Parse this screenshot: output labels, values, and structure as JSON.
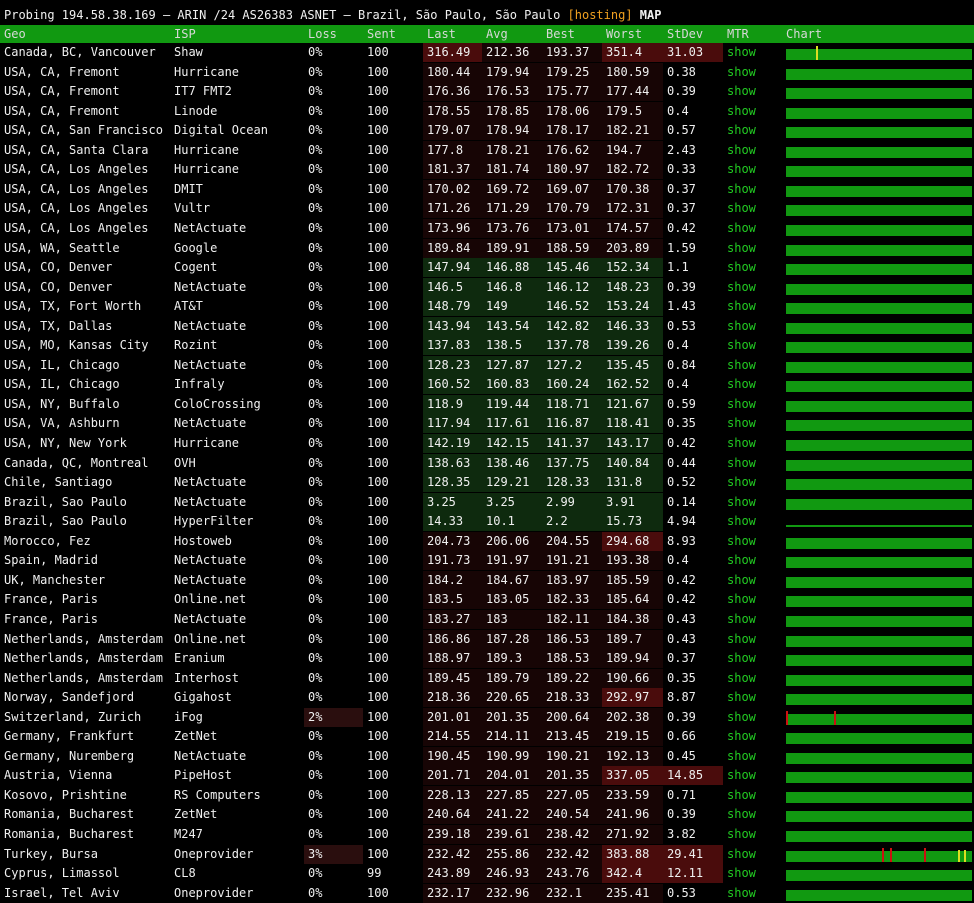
{
  "title": {
    "prefix": "Probing 194.58.38.169 – ARIN /24 AS26383 ASNET – Brazil, São Paulo, São Paulo ",
    "tag": "[hosting]",
    "map": "MAP"
  },
  "columns": [
    "Geo",
    "ISP",
    "Loss",
    "Sent",
    "Last",
    "Avg",
    "Best",
    "Worst",
    "StDev",
    "MTR",
    "Chart"
  ],
  "colors": {
    "header_bg": "#119911",
    "link": "#22cc22",
    "bar": "#119911",
    "good_bg": "#0e2a0e",
    "bad_bg": "#4a0c0c",
    "warn_bg": "#2a0e0e",
    "spike_red": "#cc1111",
    "spike_yellow": "#dddd22"
  },
  "rows": [
    {
      "geo": "Canada, BC, Vancouver",
      "isp": "Shaw",
      "loss": "0%",
      "sent": "100",
      "last": "316.49",
      "avg": "212.36",
      "best": "193.37",
      "worst": "351.4",
      "stdev": "31.03",
      "mtr": "show",
      "tone": "bad",
      "worst_bad": true,
      "stdev_bad": true
    },
    {
      "geo": "USA, CA, Fremont",
      "isp": "Hurricane",
      "loss": "0%",
      "sent": "100",
      "last": "180.44",
      "avg": "179.94",
      "best": "179.25",
      "worst": "180.59",
      "stdev": "0.38",
      "mtr": "show",
      "tone": "bad"
    },
    {
      "geo": "USA, CA, Fremont",
      "isp": "IT7 FMT2",
      "loss": "0%",
      "sent": "100",
      "last": "176.36",
      "avg": "176.53",
      "best": "175.77",
      "worst": "177.44",
      "stdev": "0.39",
      "mtr": "show",
      "tone": "bad"
    },
    {
      "geo": "USA, CA, Fremont",
      "isp": "Linode",
      "loss": "0%",
      "sent": "100",
      "last": "178.55",
      "avg": "178.85",
      "best": "178.06",
      "worst": "179.5",
      "stdev": "0.4",
      "mtr": "show",
      "tone": "bad"
    },
    {
      "geo": "USA, CA, San Francisco",
      "isp": "Digital Ocean",
      "loss": "0%",
      "sent": "100",
      "last": "179.07",
      "avg": "178.94",
      "best": "178.17",
      "worst": "182.21",
      "stdev": "0.57",
      "mtr": "show",
      "tone": "bad"
    },
    {
      "geo": "USA, CA, Santa Clara",
      "isp": "Hurricane",
      "loss": "0%",
      "sent": "100",
      "last": "177.8",
      "avg": "178.21",
      "best": "176.62",
      "worst": "194.7",
      "stdev": "2.43",
      "mtr": "show",
      "tone": "bad"
    },
    {
      "geo": "USA, CA, Los Angeles",
      "isp": "Hurricane",
      "loss": "0%",
      "sent": "100",
      "last": "181.37",
      "avg": "181.74",
      "best": "180.97",
      "worst": "182.72",
      "stdev": "0.33",
      "mtr": "show",
      "tone": "bad"
    },
    {
      "geo": "USA, CA, Los Angeles",
      "isp": "DMIT",
      "loss": "0%",
      "sent": "100",
      "last": "170.02",
      "avg": "169.72",
      "best": "169.07",
      "worst": "170.38",
      "stdev": "0.37",
      "mtr": "show",
      "tone": "bad"
    },
    {
      "geo": "USA, CA, Los Angeles",
      "isp": "Vultr",
      "loss": "0%",
      "sent": "100",
      "last": "171.26",
      "avg": "171.29",
      "best": "170.79",
      "worst": "172.31",
      "stdev": "0.37",
      "mtr": "show",
      "tone": "bad"
    },
    {
      "geo": "USA, CA, Los Angeles",
      "isp": "NetActuate",
      "loss": "0%",
      "sent": "100",
      "last": "173.96",
      "avg": "173.76",
      "best": "173.01",
      "worst": "174.57",
      "stdev": "0.42",
      "mtr": "show",
      "tone": "bad"
    },
    {
      "geo": "USA, WA, Seattle",
      "isp": "Google",
      "loss": "0%",
      "sent": "100",
      "last": "189.84",
      "avg": "189.91",
      "best": "188.59",
      "worst": "203.89",
      "stdev": "1.59",
      "mtr": "show",
      "tone": "bad"
    },
    {
      "geo": "USA, CO, Denver",
      "isp": "Cogent",
      "loss": "0%",
      "sent": "100",
      "last": "147.94",
      "avg": "146.88",
      "best": "145.46",
      "worst": "152.34",
      "stdev": "1.1",
      "mtr": "show",
      "tone": "good"
    },
    {
      "geo": "USA, CO, Denver",
      "isp": "NetActuate",
      "loss": "0%",
      "sent": "100",
      "last": "146.5",
      "avg": "146.8",
      "best": "146.12",
      "worst": "148.23",
      "stdev": "0.39",
      "mtr": "show",
      "tone": "good"
    },
    {
      "geo": "USA, TX, Fort Worth",
      "isp": "AT&T",
      "loss": "0%",
      "sent": "100",
      "last": "148.79",
      "avg": "149",
      "best": "146.52",
      "worst": "153.24",
      "stdev": "1.43",
      "mtr": "show",
      "tone": "good"
    },
    {
      "geo": "USA, TX, Dallas",
      "isp": "NetActuate",
      "loss": "0%",
      "sent": "100",
      "last": "143.94",
      "avg": "143.54",
      "best": "142.82",
      "worst": "146.33",
      "stdev": "0.53",
      "mtr": "show",
      "tone": "good"
    },
    {
      "geo": "USA, MO, Kansas City",
      "isp": "Rozint",
      "loss": "0%",
      "sent": "100",
      "last": "137.83",
      "avg": "138.5",
      "best": "137.78",
      "worst": "139.26",
      "stdev": "0.4",
      "mtr": "show",
      "tone": "good"
    },
    {
      "geo": "USA, IL, Chicago",
      "isp": "NetActuate",
      "loss": "0%",
      "sent": "100",
      "last": "128.23",
      "avg": "127.87",
      "best": "127.2",
      "worst": "135.45",
      "stdev": "0.84",
      "mtr": "show",
      "tone": "good"
    },
    {
      "geo": "USA, IL, Chicago",
      "isp": "Infraly",
      "loss": "0%",
      "sent": "100",
      "last": "160.52",
      "avg": "160.83",
      "best": "160.24",
      "worst": "162.52",
      "stdev": "0.4",
      "mtr": "show",
      "tone": "good"
    },
    {
      "geo": "USA, NY, Buffalo",
      "isp": "ColoCrossing",
      "loss": "0%",
      "sent": "100",
      "last": "118.9",
      "avg": "119.44",
      "best": "118.71",
      "worst": "121.67",
      "stdev": "0.59",
      "mtr": "show",
      "tone": "good"
    },
    {
      "geo": "USA, VA, Ashburn",
      "isp": "NetActuate",
      "loss": "0%",
      "sent": "100",
      "last": "117.94",
      "avg": "117.61",
      "best": "116.87",
      "worst": "118.41",
      "stdev": "0.35",
      "mtr": "show",
      "tone": "good"
    },
    {
      "geo": "USA, NY, New York",
      "isp": "Hurricane",
      "loss": "0%",
      "sent": "100",
      "last": "142.19",
      "avg": "142.15",
      "best": "141.37",
      "worst": "143.17",
      "stdev": "0.42",
      "mtr": "show",
      "tone": "good"
    },
    {
      "geo": "Canada, QC, Montreal",
      "isp": "OVH",
      "loss": "0%",
      "sent": "100",
      "last": "138.63",
      "avg": "138.46",
      "best": "137.75",
      "worst": "140.84",
      "stdev": "0.44",
      "mtr": "show",
      "tone": "good"
    },
    {
      "geo": "Chile, Santiago",
      "isp": "NetActuate",
      "loss": "0%",
      "sent": "100",
      "last": "128.35",
      "avg": "129.21",
      "best": "128.33",
      "worst": "131.8",
      "stdev": "0.52",
      "mtr": "show",
      "tone": "good"
    },
    {
      "geo": "Brazil, Sao Paulo",
      "isp": "NetActuate",
      "loss": "0%",
      "sent": "100",
      "last": "3.25",
      "avg": "3.25",
      "best": "2.99",
      "worst": "3.91",
      "stdev": "0.14",
      "mtr": "show",
      "tone": "good"
    },
    {
      "geo": "Brazil, Sao Paulo",
      "isp": "HyperFilter",
      "loss": "0%",
      "sent": "100",
      "last": "14.33",
      "avg": "10.1",
      "best": "2.2",
      "worst": "15.73",
      "stdev": "4.94",
      "mtr": "show",
      "tone": "good",
      "chart": "thin"
    },
    {
      "geo": "Morocco, Fez",
      "isp": "Hostoweb",
      "loss": "0%",
      "sent": "100",
      "last": "204.73",
      "avg": "206.06",
      "best": "204.55",
      "worst": "294.68",
      "stdev": "8.93",
      "mtr": "show",
      "tone": "bad",
      "worst_bad": true
    },
    {
      "geo": "Spain, Madrid",
      "isp": "NetActuate",
      "loss": "0%",
      "sent": "100",
      "last": "191.73",
      "avg": "191.97",
      "best": "191.21",
      "worst": "193.38",
      "stdev": "0.4",
      "mtr": "show",
      "tone": "bad"
    },
    {
      "geo": "UK, Manchester",
      "isp": "NetActuate",
      "loss": "0%",
      "sent": "100",
      "last": "184.2",
      "avg": "184.67",
      "best": "183.97",
      "worst": "185.59",
      "stdev": "0.42",
      "mtr": "show",
      "tone": "bad"
    },
    {
      "geo": "France, Paris",
      "isp": "Online.net",
      "loss": "0%",
      "sent": "100",
      "last": "183.5",
      "avg": "183.05",
      "best": "182.33",
      "worst": "185.64",
      "stdev": "0.42",
      "mtr": "show",
      "tone": "bad"
    },
    {
      "geo": "France, Paris",
      "isp": "NetActuate",
      "loss": "0%",
      "sent": "100",
      "last": "183.27",
      "avg": "183",
      "best": "182.11",
      "worst": "184.38",
      "stdev": "0.43",
      "mtr": "show",
      "tone": "bad"
    },
    {
      "geo": "Netherlands, Amsterdam",
      "isp": "Online.net",
      "loss": "0%",
      "sent": "100",
      "last": "186.86",
      "avg": "187.28",
      "best": "186.53",
      "worst": "189.7",
      "stdev": "0.43",
      "mtr": "show",
      "tone": "bad"
    },
    {
      "geo": "Netherlands, Amsterdam",
      "isp": "Eranium",
      "loss": "0%",
      "sent": "100",
      "last": "188.97",
      "avg": "189.3",
      "best": "188.53",
      "worst": "189.94",
      "stdev": "0.37",
      "mtr": "show",
      "tone": "bad"
    },
    {
      "geo": "Netherlands, Amsterdam",
      "isp": "Interhost",
      "loss": "0%",
      "sent": "100",
      "last": "189.45",
      "avg": "189.79",
      "best": "189.22",
      "worst": "190.66",
      "stdev": "0.35",
      "mtr": "show",
      "tone": "bad"
    },
    {
      "geo": "Norway, Sandefjord",
      "isp": "Gigahost",
      "loss": "0%",
      "sent": "100",
      "last": "218.36",
      "avg": "220.65",
      "best": "218.33",
      "worst": "292.97",
      "stdev": "8.87",
      "mtr": "show",
      "tone": "bad",
      "worst_bad": true
    },
    {
      "geo": "Switzerland, Zurich",
      "isp": "iFog",
      "loss": "2%",
      "sent": "100",
      "last": "201.01",
      "avg": "201.35",
      "best": "200.64",
      "worst": "202.38",
      "stdev": "0.39",
      "mtr": "show",
      "tone": "bad",
      "loss_bad": true,
      "chart": "gaps"
    },
    {
      "geo": "Germany, Frankfurt",
      "isp": "ZetNet",
      "loss": "0%",
      "sent": "100",
      "last": "214.55",
      "avg": "214.11",
      "best": "213.45",
      "worst": "219.15",
      "stdev": "0.66",
      "mtr": "show",
      "tone": "bad"
    },
    {
      "geo": "Germany, Nuremberg",
      "isp": "NetActuate",
      "loss": "0%",
      "sent": "100",
      "last": "190.45",
      "avg": "190.99",
      "best": "190.21",
      "worst": "192.13",
      "stdev": "0.45",
      "mtr": "show",
      "tone": "bad"
    },
    {
      "geo": "Austria, Vienna",
      "isp": "PipeHost",
      "loss": "0%",
      "sent": "100",
      "last": "201.71",
      "avg": "204.01",
      "best": "201.35",
      "worst": "337.05",
      "stdev": "14.85",
      "mtr": "show",
      "tone": "bad",
      "worst_bad": true,
      "stdev_bad": true
    },
    {
      "geo": "Kosovo, Prishtine",
      "isp": "RS Computers",
      "loss": "0%",
      "sent": "100",
      "last": "228.13",
      "avg": "227.85",
      "best": "227.05",
      "worst": "233.59",
      "stdev": "0.71",
      "mtr": "show",
      "tone": "bad"
    },
    {
      "geo": "Romania, Bucharest",
      "isp": "ZetNet",
      "loss": "0%",
      "sent": "100",
      "last": "240.64",
      "avg": "241.22",
      "best": "240.54",
      "worst": "241.96",
      "stdev": "0.39",
      "mtr": "show",
      "tone": "bad"
    },
    {
      "geo": "Romania, Bucharest",
      "isp": "M247",
      "loss": "0%",
      "sent": "100",
      "last": "239.18",
      "avg": "239.61",
      "best": "238.42",
      "worst": "271.92",
      "stdev": "3.82",
      "mtr": "show",
      "tone": "bad"
    },
    {
      "geo": "Turkey, Bursa",
      "isp": "Oneprovider",
      "loss": "3%",
      "sent": "100",
      "last": "232.42",
      "avg": "255.86",
      "best": "232.42",
      "worst": "383.88",
      "stdev": "29.41",
      "mtr": "show",
      "tone": "bad",
      "loss_bad": true,
      "worst_bad": true,
      "stdev_bad": true,
      "chart": "spiky"
    },
    {
      "geo": "Cyprus, Limassol",
      "isp": "CL8",
      "loss": "0%",
      "sent": "99",
      "last": "243.89",
      "avg": "246.93",
      "best": "243.76",
      "worst": "342.4",
      "stdev": "12.11",
      "mtr": "show",
      "tone": "bad",
      "worst_bad": true,
      "stdev_bad": true
    },
    {
      "geo": "Israel, Tel Aviv",
      "isp": "Oneprovider",
      "loss": "0%",
      "sent": "100",
      "last": "232.17",
      "avg": "232.96",
      "best": "232.1",
      "worst": "235.41",
      "stdev": "0.53",
      "mtr": "show",
      "tone": "bad"
    }
  ]
}
